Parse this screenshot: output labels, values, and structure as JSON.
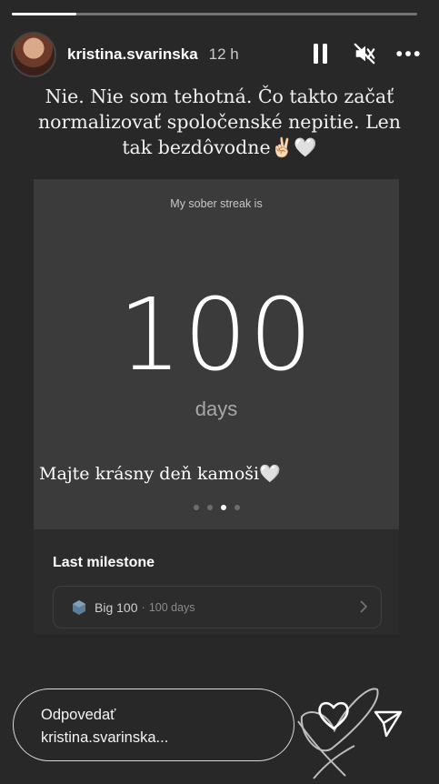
{
  "story": {
    "progress_fraction": 0.16
  },
  "header": {
    "username": "kristina.svarinska",
    "time_ago": "12 h",
    "icons": {
      "pause": "pause-icon",
      "mute": "muted-speaker-icon",
      "more": "more-dots-icon"
    }
  },
  "caption": {
    "line1": "Nie. Nie som tehotná. Čo takto začať",
    "line2": "normalizovať spoločenské nepitie. Len",
    "line3": "tak bezdôvodne✌🏻🤍"
  },
  "card": {
    "streak_label": "My sober streak is",
    "streak_value": "100",
    "streak_unit": "days",
    "overlay_text": "Majte krásny deň kamoši🤍",
    "pager": {
      "count": 4,
      "active_index": 2
    }
  },
  "milestone": {
    "title": "Last milestone",
    "name": "Big 100",
    "separator": "·",
    "days": "100 days"
  },
  "reply": {
    "line1": "Odpovedať",
    "line2": "kristina.svarinska..."
  },
  "actions": {
    "like": "heart-icon",
    "share": "paper-plane-icon"
  },
  "colors": {
    "background": "#282828",
    "card": "#3b3b3b",
    "milestone_panel": "#2c2c2c"
  }
}
